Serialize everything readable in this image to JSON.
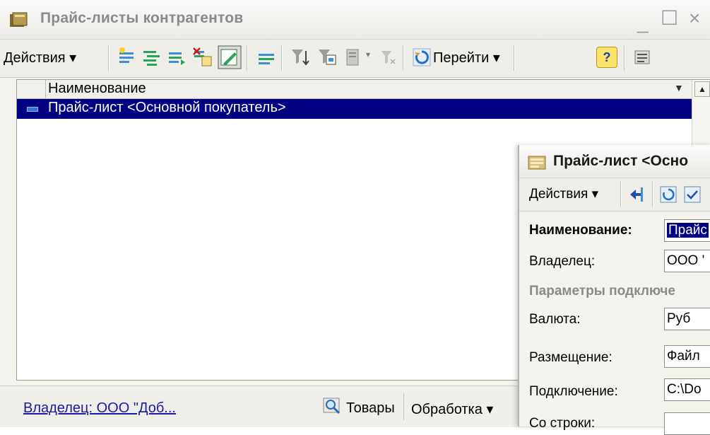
{
  "main_window": {
    "title": "Прайс-листы контрагентов",
    "toolbar": {
      "actions_label": "Действия ▾",
      "goto_label": "Перейти ▾",
      "help_label": "?"
    },
    "table": {
      "column_header": "Наименование",
      "rows": [
        {
          "name": "Прайс-лист <Основной покупатель>",
          "selected": true
        }
      ]
    },
    "status_bar": {
      "owner_link": "Владелец: ООО \"Доб...",
      "goods_label": "Товары",
      "processing_label": "Обработка ▾"
    }
  },
  "detail_window": {
    "title": "Прайс-лист <Осно",
    "toolbar": {
      "actions_label": "Действия ▾"
    },
    "fields": {
      "name_label": "Наименование:",
      "name_value": "Прайс",
      "owner_label": "Владелец:",
      "owner_value": "ООО '",
      "group_header": "Параметры подключе",
      "currency_label": "Валюта:",
      "currency_value": "Руб",
      "placement_label": "Размещение:",
      "placement_value": "Файл",
      "connection_label": "Подключение:",
      "connection_value": "C:\\Do",
      "from_row_label": "Со строки:"
    }
  },
  "colors": {
    "selection": "#000080",
    "link": "#1a1aa6",
    "title_text": "#8a8a8a"
  }
}
